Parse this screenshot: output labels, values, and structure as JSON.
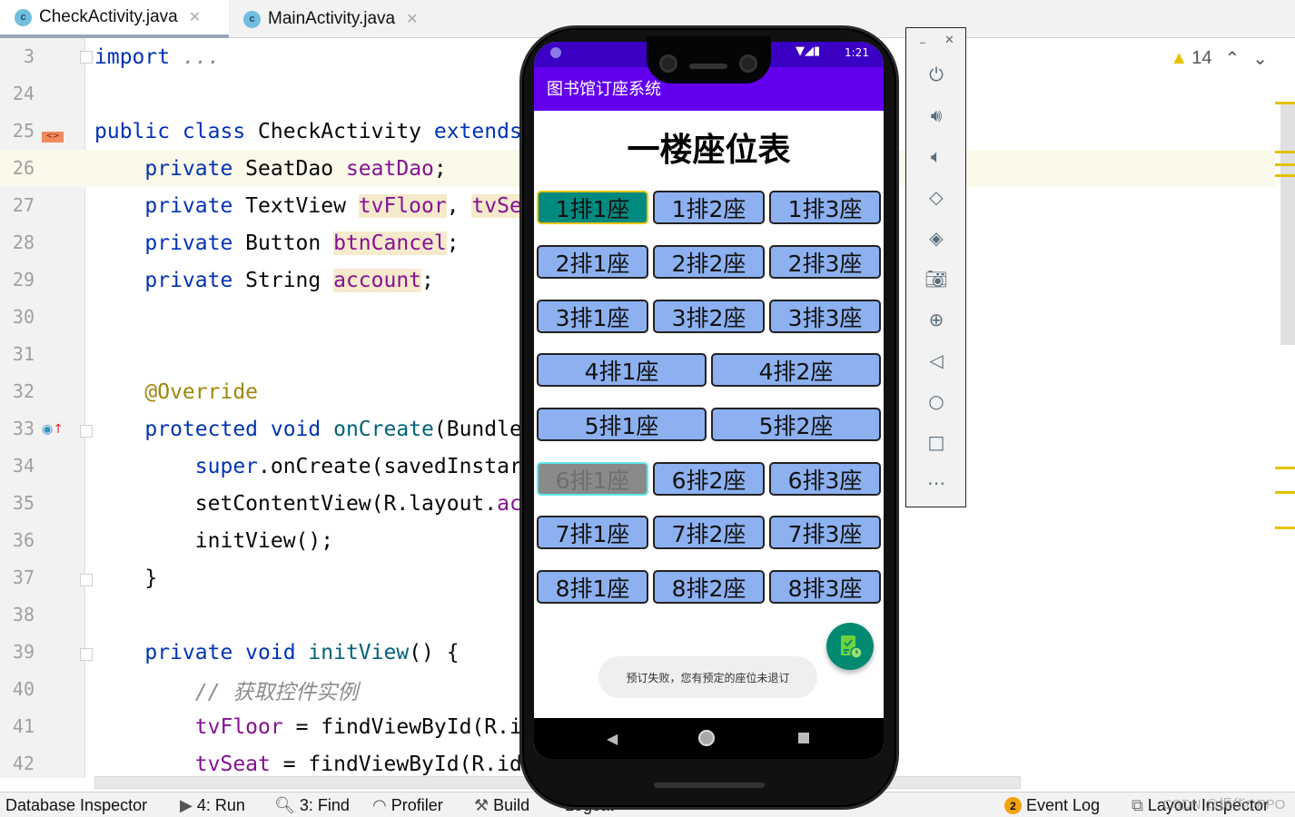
{
  "tabs": [
    {
      "label": "CheckActivity.java",
      "icon": "java-class-icon",
      "active": true
    },
    {
      "label": "MainActivity.java",
      "icon": "java-class-icon",
      "active": false
    }
  ],
  "editor": {
    "lines": [
      {
        "num": "3",
        "tokens": [
          {
            "t": "import",
            "c": "kw"
          },
          {
            "t": " "
          },
          {
            "t": "...",
            "c": "cm"
          }
        ]
      },
      {
        "num": "24",
        "tokens": []
      },
      {
        "num": "25",
        "tokens": [
          {
            "t": "public class ",
            "c": "kw"
          },
          {
            "t": "CheckActivity ",
            "c": "plain"
          },
          {
            "t": "extends",
            "c": "kw"
          }
        ]
      },
      {
        "num": "26",
        "tokens": [
          {
            "t": "    private ",
            "c": "kw"
          },
          {
            "t": "SeatDao ",
            "c": "plain"
          },
          {
            "t": "seatDao",
            "c": "fld"
          },
          {
            "t": ";",
            "c": "plain"
          }
        ]
      },
      {
        "num": "27",
        "tokens": [
          {
            "t": "    private ",
            "c": "kw"
          },
          {
            "t": "TextView ",
            "c": "plain"
          },
          {
            "t": "tvFloor",
            "c": "fld usage"
          },
          {
            "t": ", ",
            "c": "plain"
          },
          {
            "t": "tvSe",
            "c": "fld usage"
          }
        ]
      },
      {
        "num": "28",
        "tokens": [
          {
            "t": "    private ",
            "c": "kw"
          },
          {
            "t": "Button ",
            "c": "plain"
          },
          {
            "t": "btnCancel",
            "c": "fld usage"
          },
          {
            "t": ";",
            "c": "plain"
          }
        ]
      },
      {
        "num": "29",
        "tokens": [
          {
            "t": "    private ",
            "c": "kw"
          },
          {
            "t": "String ",
            "c": "plain"
          },
          {
            "t": "account",
            "c": "fld usage"
          },
          {
            "t": ";",
            "c": "plain"
          }
        ]
      },
      {
        "num": "30",
        "tokens": []
      },
      {
        "num": "31",
        "tokens": []
      },
      {
        "num": "32",
        "tokens": [
          {
            "t": "    @Override",
            "c": "ann"
          }
        ]
      },
      {
        "num": "33",
        "tokens": [
          {
            "t": "    protected void ",
            "c": "kw"
          },
          {
            "t": "onCreate",
            "c": "fn"
          },
          {
            "t": "(Bundle",
            "c": "plain"
          }
        ]
      },
      {
        "num": "34",
        "tokens": [
          {
            "t": "        super",
            "c": "kw"
          },
          {
            "t": ".onCreate(savedInstar",
            "c": "plain"
          }
        ]
      },
      {
        "num": "35",
        "tokens": [
          {
            "t": "        setContentView(R.layout.",
            "c": "plain"
          },
          {
            "t": "ac",
            "c": "fld"
          }
        ]
      },
      {
        "num": "36",
        "tokens": [
          {
            "t": "        initView();",
            "c": "plain"
          }
        ]
      },
      {
        "num": "37",
        "tokens": [
          {
            "t": "    }",
            "c": "plain"
          }
        ]
      },
      {
        "num": "38",
        "tokens": []
      },
      {
        "num": "39",
        "tokens": [
          {
            "t": "    private void ",
            "c": "kw"
          },
          {
            "t": "initView",
            "c": "fn"
          },
          {
            "t": "() {",
            "c": "plain"
          }
        ]
      },
      {
        "num": "40",
        "tokens": [
          {
            "t": "        // 获取控件实例",
            "c": "cm"
          }
        ]
      },
      {
        "num": "41",
        "tokens": [
          {
            "t": "        tvFloor",
            "c": "fld"
          },
          {
            "t": " = findViewById(R.i",
            "c": "plain"
          }
        ]
      },
      {
        "num": "42",
        "tokens": [
          {
            "t": "        tvSeat",
            "c": "fld"
          },
          {
            "t": " = findViewById(R.id",
            "c": "plain"
          }
        ]
      }
    ],
    "warnings_count": "14"
  },
  "phone": {
    "time": "1:21",
    "app_title": "图书馆订座系统",
    "page_title": "一楼座位表",
    "seat_rows": [
      [
        {
          "label": "1排1座",
          "state": "selected"
        },
        {
          "label": "1排2座",
          "state": "normal"
        },
        {
          "label": "1排3座",
          "state": "normal"
        }
      ],
      [
        {
          "label": "2排1座",
          "state": "normal"
        },
        {
          "label": "2排2座",
          "state": "normal"
        },
        {
          "label": "2排3座",
          "state": "normal"
        }
      ],
      [
        {
          "label": "3排1座",
          "state": "normal"
        },
        {
          "label": "3排2座",
          "state": "normal"
        },
        {
          "label": "3排3座",
          "state": "normal"
        }
      ],
      [
        {
          "label": "4排1座",
          "state": "normal"
        },
        {
          "label": "4排2座",
          "state": "normal"
        }
      ],
      [
        {
          "label": "5排1座",
          "state": "normal"
        },
        {
          "label": "5排2座",
          "state": "normal"
        }
      ],
      [
        {
          "label": "6排1座",
          "state": "disabled"
        },
        {
          "label": "6排2座",
          "state": "normal"
        },
        {
          "label": "6排3座",
          "state": "normal"
        }
      ],
      [
        {
          "label": "7排1座",
          "state": "normal"
        },
        {
          "label": "7排2座",
          "state": "normal"
        },
        {
          "label": "7排3座",
          "state": "normal"
        }
      ],
      [
        {
          "label": "8排1座",
          "state": "normal"
        },
        {
          "label": "8排2座",
          "state": "normal"
        },
        {
          "label": "8排3座",
          "state": "normal"
        }
      ]
    ],
    "toast": "预订失败，您有预定的座位未退订",
    "colors": {
      "appbar": "#6200ee",
      "seat": "#8cb0f0",
      "selected": "#008a80",
      "fab": "#058a72"
    }
  },
  "emulator_toolbar": {
    "items": [
      "power-icon",
      "volume-up-icon",
      "volume-down-icon",
      "rotate-left-icon",
      "rotate-right-icon",
      "camera-icon",
      "zoom-in-icon",
      "back-icon",
      "home-icon",
      "overview-icon",
      "more-icon"
    ]
  },
  "statusbar": {
    "items": [
      {
        "label": "Database Inspector"
      },
      {
        "label": "4: Run"
      },
      {
        "label": "3: Find"
      },
      {
        "label": "Profiler"
      },
      {
        "label": "Build"
      },
      {
        "label": "Logcat"
      }
    ],
    "event_log": {
      "label": "Event Log",
      "badge": "2"
    },
    "layout_inspector": "Layout Inspector",
    "watermark": "CSDN @振华OPPO"
  }
}
